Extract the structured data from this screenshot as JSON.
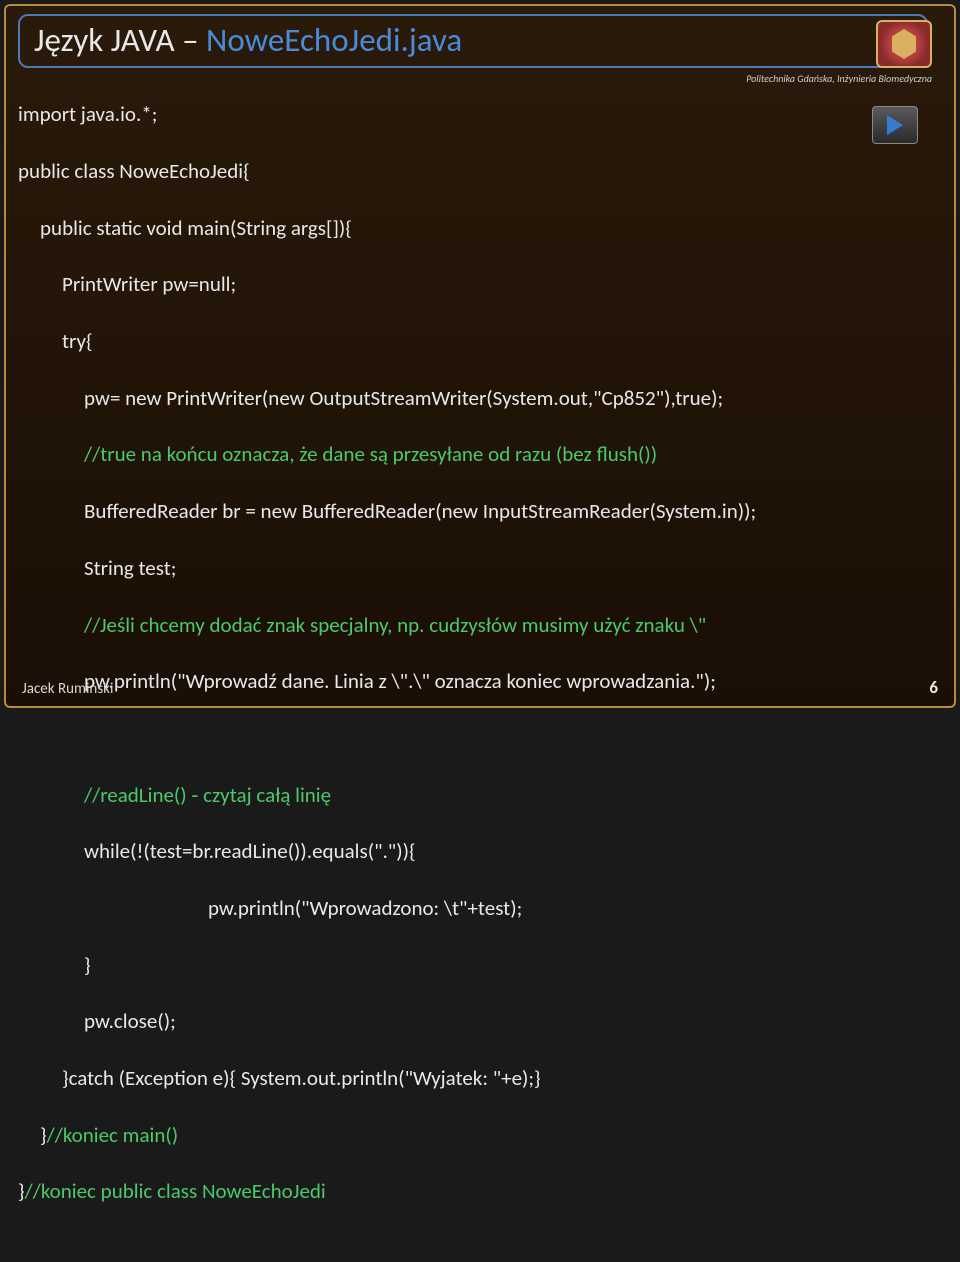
{
  "header": {
    "title_part1": "Język JAVA – ",
    "title_part2": "NoweEchoJedi.java",
    "affiliation": "Politechnika Gdańska, Inżynieria Biomedyczna",
    "play_label": "play"
  },
  "code": {
    "l1": "import java.io.*;",
    "l2": "public class NoweEchoJedi{",
    "l3": "public static void main(String args[]){",
    "l4": "PrintWriter pw=null;",
    "l5": "try{",
    "l6": "pw= new PrintWriter(new OutputStreamWriter(System.out,\"Cp852\"),true);",
    "l7a": "//true na końcu oznacza, że dane są przesyłane od razu (bez flush())",
    "l8": "BufferedReader br = new BufferedReader(new InputStreamReader(System.in));",
    "l9": "String test;",
    "l10a": "//Jeśli chcemy dodać znak specjalny, np. cudzysłów musimy użyć znaku \\\"",
    "l11": "pw.println(\"Wprowadź dane. Linia z \\\".\\\" oznacza koniec wprowadzania.\");",
    "l12": "",
    "l13a": "//readLine() ‐ czytaj całą linię",
    "l14": "while(!(test=br.readLine()).equals(\".\")){",
    "l15": "pw.println(\"Wprowadzono: \\t\"+test);",
    "l16": "}",
    "l17": "pw.close();",
    "l18a": "}catch (Exception e){ System.out.println(\"Wyjatek: \"+e);}",
    "l19a": "}",
    "l19b": "//koniec main()",
    "l20a": "}",
    "l20b": "//koniec public class NoweEchoJedi"
  },
  "footer": {
    "author": "Jacek Rumiński",
    "page": "6"
  }
}
